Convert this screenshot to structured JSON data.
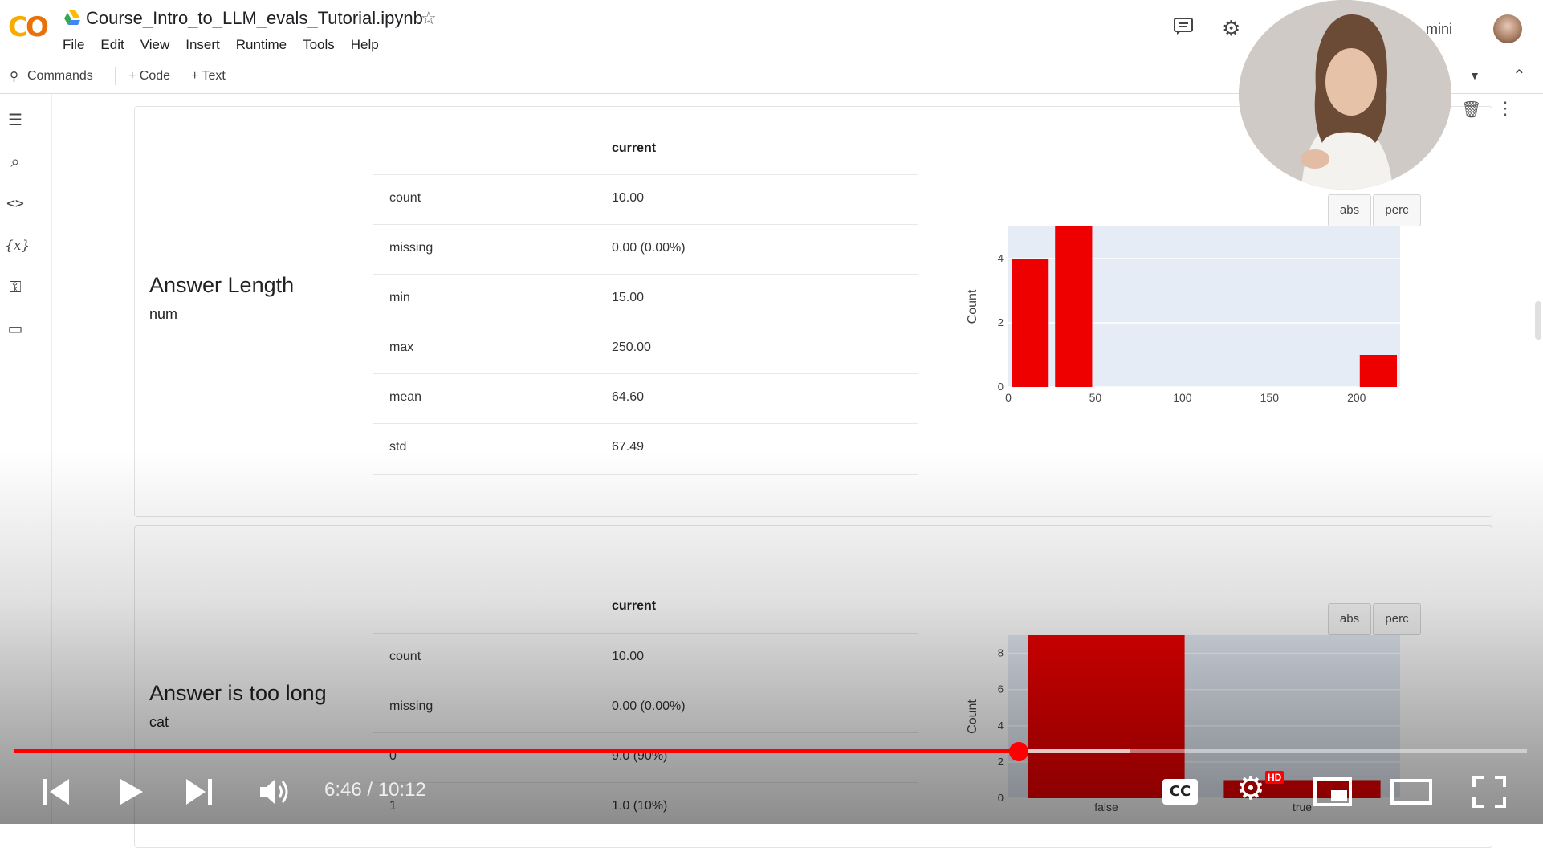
{
  "notebook": {
    "title": "Course_Intro_to_LLM_evals_Tutorial.ipynb",
    "menu": [
      "File",
      "Edit",
      "View",
      "Insert",
      "Runtime",
      "Tools",
      "Help"
    ],
    "toolbar": {
      "commands": "Commands",
      "code": "+ Code",
      "text": "+ Text"
    },
    "gemini_label": "mini"
  },
  "features": [
    {
      "title": "Answer Length",
      "type": "num",
      "column_header": "current",
      "rows": [
        {
          "k": "count",
          "v": "10.00"
        },
        {
          "k": "missing",
          "v": "0.00 (0.00%)"
        },
        {
          "k": "min",
          "v": "15.00"
        },
        {
          "k": "max",
          "v": "250.00"
        },
        {
          "k": "mean",
          "v": "64.60"
        },
        {
          "k": "std",
          "v": "67.49"
        }
      ],
      "buttons": {
        "abs": "abs",
        "perc": "perc"
      }
    },
    {
      "title": "Answer is too long",
      "type": "cat",
      "column_header": "current",
      "rows": [
        {
          "k": "count",
          "v": "10.00"
        },
        {
          "k": "missing",
          "v": "0.00 (0.00%)"
        },
        {
          "k": "0",
          "v": "9.0 (90%)"
        },
        {
          "k": "1",
          "v": "1.0 (10%)"
        }
      ],
      "buttons": {
        "abs": "abs",
        "perc": "perc"
      }
    }
  ],
  "chart_data": [
    {
      "type": "bar",
      "x_bins": [
        [
          0,
          25
        ],
        [
          25,
          50
        ],
        [
          200,
          225
        ]
      ],
      "values": [
        4,
        5,
        1
      ],
      "xlabel": "",
      "ylabel": "Count",
      "xticks": [
        "0",
        "50",
        "100",
        "150",
        "200"
      ],
      "yticks": [
        "0",
        "2",
        "4"
      ],
      "xlim": [
        0,
        225
      ],
      "ylim": [
        0,
        5
      ],
      "color": "#ee0000",
      "grid": true
    },
    {
      "type": "bar",
      "categories": [
        "false",
        "true"
      ],
      "values": [
        9,
        1
      ],
      "xlabel": "",
      "ylabel": "Count",
      "yticks": [
        "0",
        "2",
        "4",
        "6",
        "8"
      ],
      "ylim": [
        0,
        9
      ],
      "color": "#ee0000",
      "grid": true
    }
  ],
  "player": {
    "time": "6:46 / 10:12",
    "progress": 0.664,
    "buffered": 0.737,
    "badge": "HD",
    "accent": "#ff0000"
  }
}
